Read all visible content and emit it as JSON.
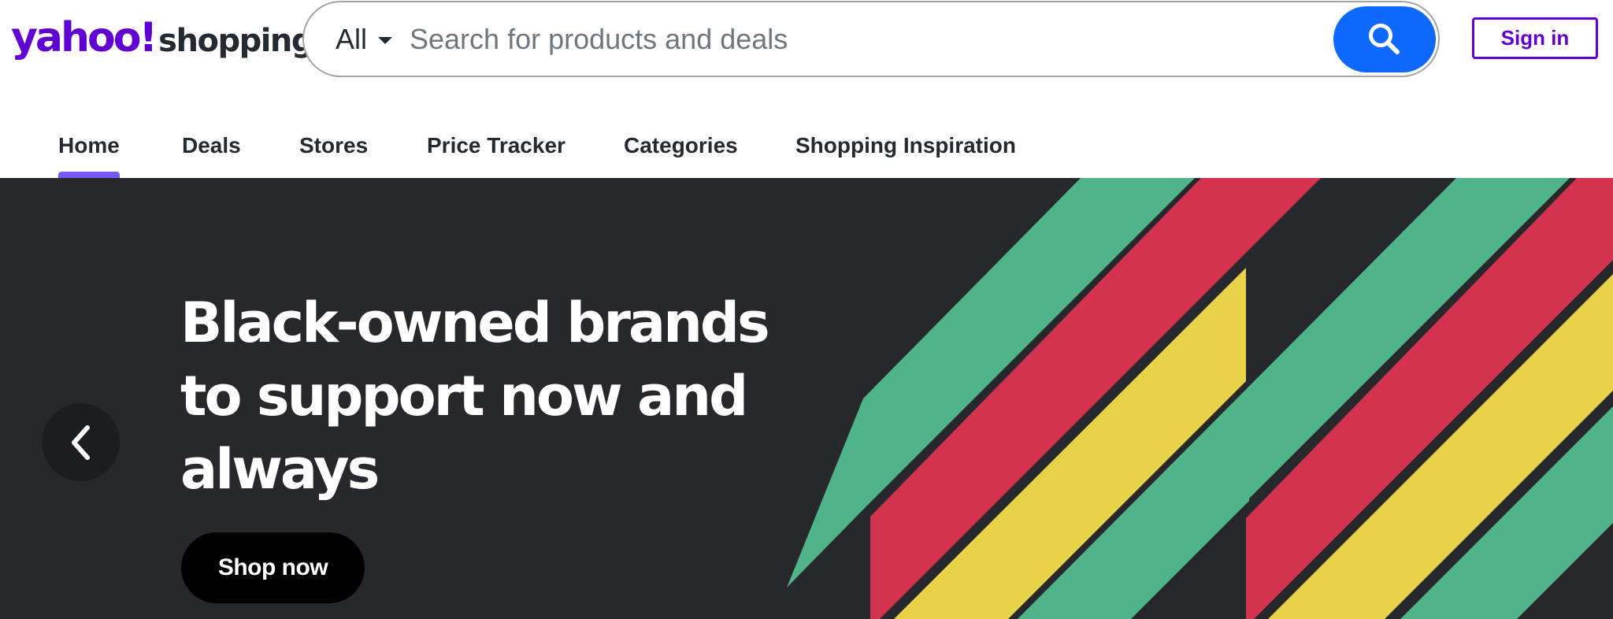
{
  "header": {
    "logo": {
      "brand": "yahoo!",
      "product": "shopping"
    },
    "search": {
      "scope_label": "All",
      "placeholder": "Search for products and deals",
      "value": "",
      "button_icon": "search-icon"
    },
    "signin_label": "Sign in"
  },
  "nav": {
    "items": [
      {
        "label": "Home",
        "active": true
      },
      {
        "label": "Deals",
        "active": false
      },
      {
        "label": "Stores",
        "active": false
      },
      {
        "label": "Price Tracker",
        "active": false
      },
      {
        "label": "Categories",
        "active": false
      },
      {
        "label": "Shopping Inspiration",
        "active": false
      }
    ]
  },
  "hero": {
    "headline_lines": [
      "Black-owned brands",
      "to support now and",
      "always"
    ],
    "cta_label": "Shop now",
    "prev_icon": "chevron-left-icon",
    "background_color": "#27282c",
    "stripe_colors": [
      "#4fb487",
      "#d3334f",
      "#e8d24a"
    ]
  },
  "colors": {
    "brand": "#6001d2",
    "search_button": "#0f69ff",
    "active_tab_indicator": "#7759f7"
  }
}
